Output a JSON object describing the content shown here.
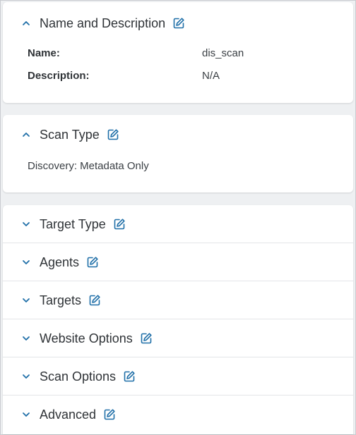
{
  "sections": {
    "name_description": {
      "title": "Name and Description",
      "fields": [
        {
          "label": "Name:",
          "value": "dis_scan"
        },
        {
          "label": "Description:",
          "value": "N/A"
        }
      ]
    },
    "scan_type": {
      "title": "Scan Type",
      "value": "Discovery: Metadata Only"
    },
    "collapsed": [
      {
        "title": "Target Type"
      },
      {
        "title": "Agents"
      },
      {
        "title": "Targets"
      },
      {
        "title": "Website Options"
      },
      {
        "title": "Scan Options"
      },
      {
        "title": "Advanced"
      }
    ]
  },
  "colors": {
    "accent": "#1f6fa8",
    "text": "#2f3337",
    "background": "#eef0f2",
    "card": "#ffffff"
  },
  "icons": {
    "expanded": "chevron-up-icon",
    "collapsed": "chevron-down-icon",
    "edit": "edit-icon"
  }
}
